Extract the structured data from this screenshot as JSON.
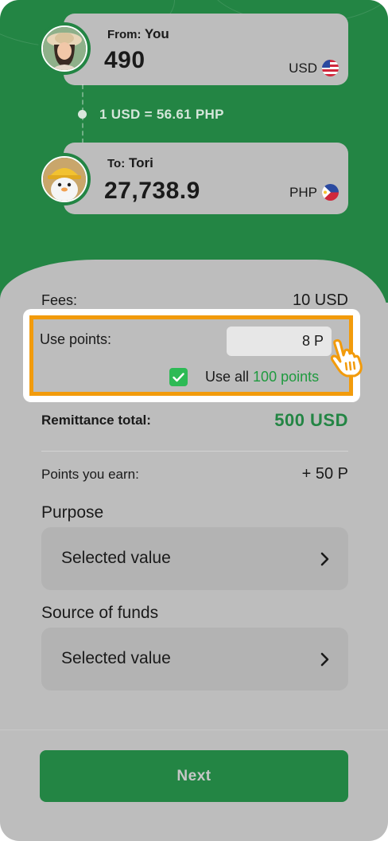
{
  "sender": {
    "prefix": "From:",
    "name": "You",
    "amount": "490",
    "currency": "USD"
  },
  "rate": "1 USD = 56.61 PHP",
  "recipient": {
    "prefix": "To:",
    "name": "Tori",
    "amount": "27,738.9",
    "currency": "PHP"
  },
  "fees": {
    "label": "Fees:",
    "value": "10 USD"
  },
  "points": {
    "label": "Use points:",
    "input_value": "8 P",
    "use_all_prefix": "Use all",
    "use_all_amount": "100 points",
    "use_all_checked": true
  },
  "total": {
    "label": "Remittance total:",
    "value": "500 USD"
  },
  "earn": {
    "label": "Points you earn:",
    "value": "+ 50 P"
  },
  "purpose": {
    "title": "Purpose",
    "value": "Selected value"
  },
  "source": {
    "title": "Source of funds",
    "value": "Selected value"
  },
  "next_button": "Next",
  "colors": {
    "brand_green": "#238544",
    "highlight_orange": "#f29b0c",
    "check_green": "#2dba55"
  },
  "icons": [
    "usa-flag-icon",
    "philippines-flag-icon",
    "checkbox-checked-icon",
    "hand-pointer-icon",
    "chevron-right-icon"
  ]
}
